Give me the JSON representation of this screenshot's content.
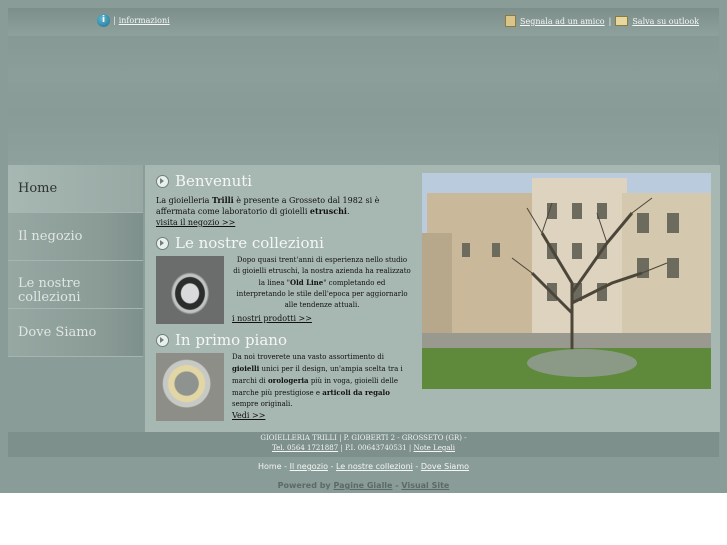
{
  "topbar": {
    "info_label": "informazioni",
    "signal_label": "Segnala ad un amico",
    "save_label": "Salva su outlook"
  },
  "nav": {
    "items": [
      {
        "label": "Home"
      },
      {
        "label": "Il negozio"
      },
      {
        "label": "Le nostre collezioni"
      },
      {
        "label": "Dove Siamo"
      }
    ]
  },
  "sections": {
    "welcome": {
      "title": "Benvenuti",
      "text_a": "La gioielleria ",
      "text_b": "Trilli",
      "text_c": " è presente a Grosseto dal 1982 si è affermata come laboratorio di gioielli ",
      "text_d": "etruschi",
      "text_e": ".",
      "link": "visita il negozio >>"
    },
    "collections": {
      "title": "Le nostre collezioni",
      "text_a": "Dopo quasi trent'anni di esperienza nello studio di gioielli etruschi, la nostra azienda ha realizzato la linea \"",
      "text_b": "Old Line",
      "text_c": "\" completando ed interpretando le stile dell'epoca per aggiornarlo alle tendenze attuali.",
      "link": "i nostri prodotti >>"
    },
    "featured": {
      "title": "In primo piano",
      "text_a": "Da noi troverete una vasto assortimento di ",
      "text_b": "gioielli",
      "text_c": " unici per il design, un'ampia scelta tra i marchi di ",
      "text_d": "orologeria",
      "text_e": " più in voga, gioielli delle marche più prestigiose e ",
      "text_f": "articoli da regalo",
      "text_g": " sempre originali.",
      "link": "Vedi >>"
    }
  },
  "footer": {
    "address": "GIOIELLERIA TRILLI | P. GIOBERTI 2 - GROSSETO (GR) -",
    "phone": "Tel. 0564 1721887",
    "piva": "| P.I. 00643740531 |",
    "legal": "Note Legali",
    "links": [
      "Home",
      "Il negozio",
      "Le nostre collezioni",
      "Dove Siamo"
    ],
    "powered_by": "Powered by",
    "pagine_gialle": "Pagine Gialle",
    "separator": "-",
    "visual_site": "Visual Site"
  }
}
